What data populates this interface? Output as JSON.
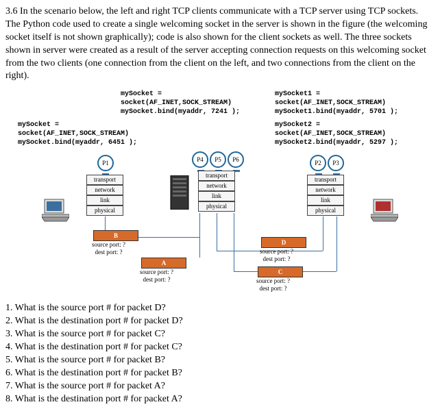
{
  "problem": {
    "prefix": "3.6",
    "text": "In the scenario below, the left and right TCP clients communicate with a TCP server using TCP sockets. The Python code used to create a single welcoming socket in the server is shown in the figure (the welcoming socket itself is not shown graphically); code is also shown for the client sockets as well. The three sockets shown in server were created as a result of the server accepting connection requests on this welcoming socket from the two clients (one connection from the client on the left, and two connections from the client on the right)."
  },
  "code": {
    "server": {
      "line1": "mySocket =",
      "line2": "  socket(AF_INET,SOCK_STREAM)",
      "line3": "mySocket.bind(myaddr, 7241   );"
    },
    "client_left": {
      "line1": "mySocket =",
      "line2": "  socket(AF_INET,SOCK_STREAM)",
      "line3": "mySocket.bind(myaddr, 6451   );"
    },
    "client_right1": {
      "line1": "mySocket1 =",
      "line2": "  socket(AF_INET,SOCK_STREAM)",
      "line3": "mySocket1.bind(myaddr, 5701   );"
    },
    "client_right2": {
      "line1": "mySocket2 =",
      "line2": "  socket(AF_INET,SOCK_STREAM)",
      "line3": "mySocket2.bind(myaddr, 5297   );"
    }
  },
  "ports": {
    "P1": "P1",
    "P2": "P2",
    "P3": "P3",
    "P4": "P4",
    "P5": "P5",
    "P6": "P6"
  },
  "layers": {
    "transport": "transport",
    "network": "network",
    "link": "link",
    "physical": "physical"
  },
  "packets": {
    "A": {
      "name": "A",
      "src": "source port: ?",
      "dst": "dest port: ?"
    },
    "B": {
      "name": "B",
      "src": "source port: ?",
      "dst": "dest port: ?"
    },
    "C": {
      "name": "C",
      "src": "source port: ?",
      "dst": "dest port: ?"
    },
    "D": {
      "name": "D",
      "src": "source port: ?",
      "dst": "dest port: ?"
    }
  },
  "questions": [
    "1. What is the source port # for packet D?",
    "2. What is the destination port # for packet D?",
    "3. What is the source port # for packet C?",
    "4. What is the destination port # for packet C?",
    "5. What is the source port # for packet B?",
    "6. What is the destination port # for packet B?",
    "7. What is the source port # for packet A?",
    "8. What is the destination port # for packet A?"
  ]
}
